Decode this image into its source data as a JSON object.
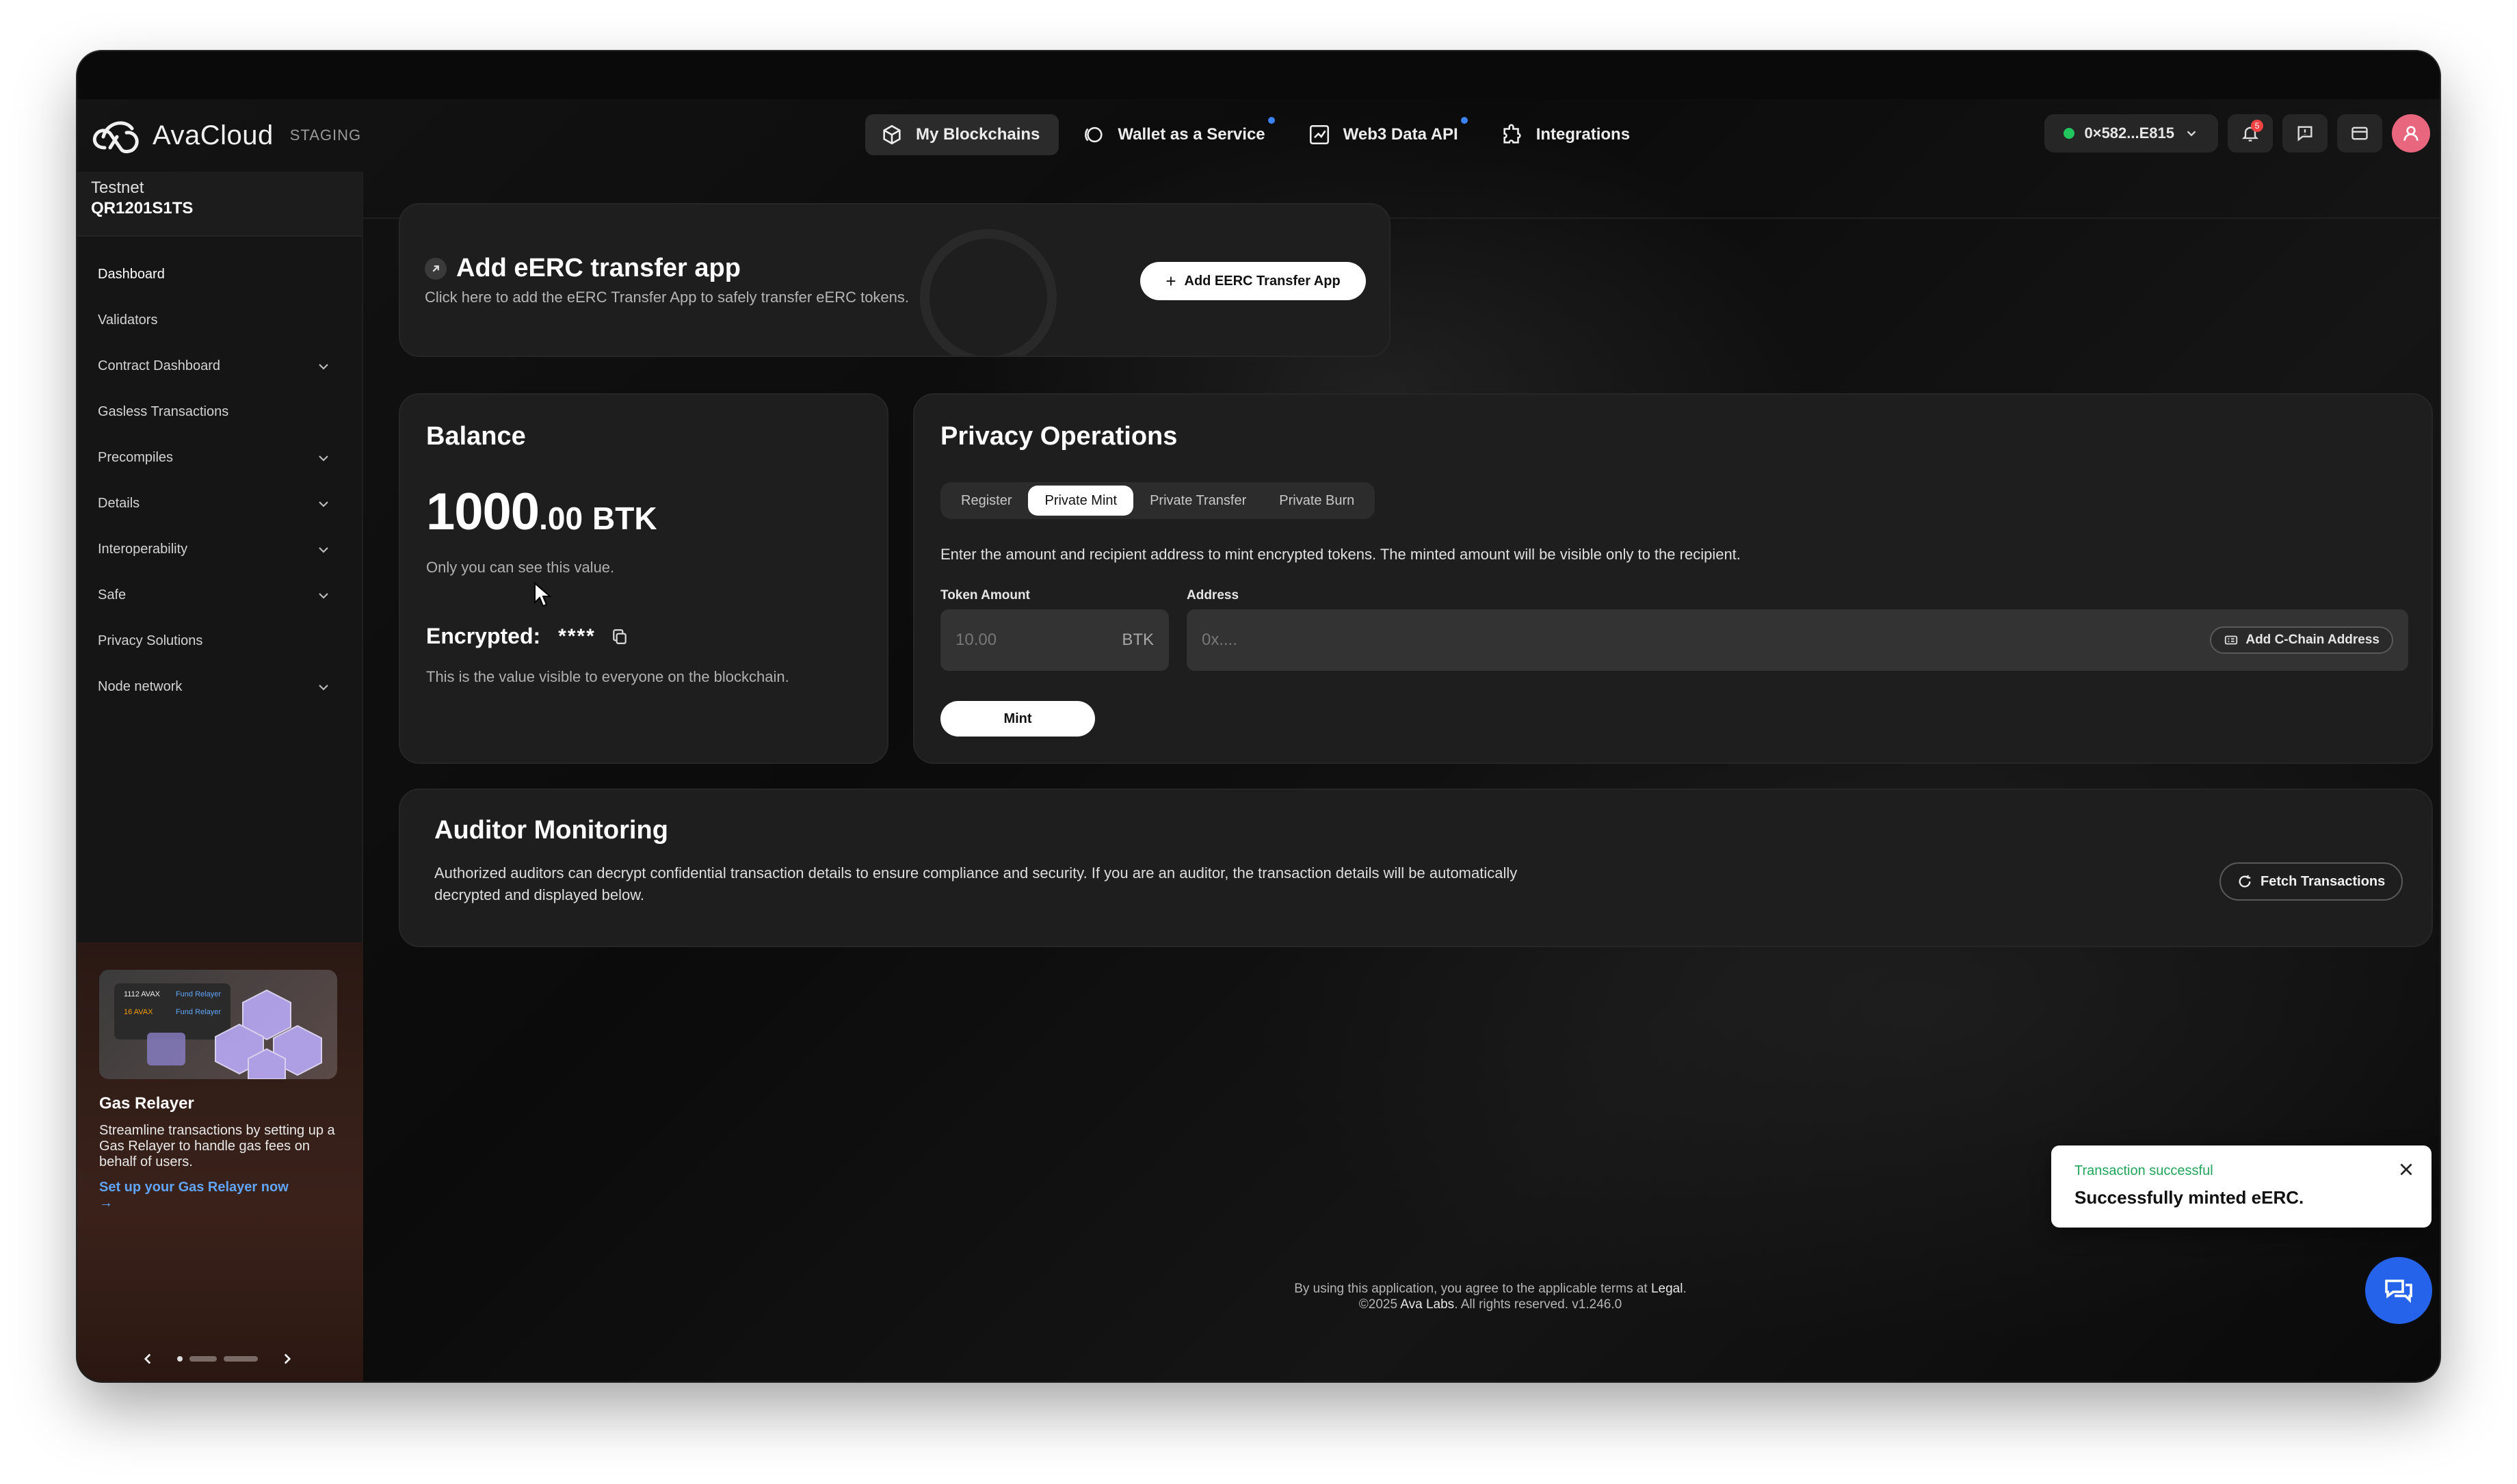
{
  "brand": {
    "name": "AvaCloud",
    "env": "STAGING"
  },
  "nav": {
    "items": [
      {
        "label": "My Blockchains",
        "icon": "blockchain-icon",
        "active": true,
        "dot": false
      },
      {
        "label": "Wallet as a Service",
        "icon": "wallet-icon",
        "active": false,
        "dot": true
      },
      {
        "label": "Web3 Data API",
        "icon": "chart-icon",
        "active": false,
        "dot": true
      },
      {
        "label": "Integrations",
        "icon": "puzzle-icon",
        "active": false,
        "dot": false
      }
    ],
    "wallet_address": "0×582...E815",
    "notification_count": "5"
  },
  "sidebar": {
    "network": "Testnet",
    "chain_id": "QR1201S1TS",
    "items": [
      {
        "label": "Dashboard",
        "expandable": false
      },
      {
        "label": "Validators",
        "expandable": false
      },
      {
        "label": "Contract Dashboard",
        "expandable": true
      },
      {
        "label": "Gasless Transactions",
        "expandable": false
      },
      {
        "label": "Precompiles",
        "expandable": true
      },
      {
        "label": "Details",
        "expandable": true
      },
      {
        "label": "Interoperability",
        "expandable": true
      },
      {
        "label": "Safe",
        "expandable": true
      },
      {
        "label": "Privacy Solutions",
        "expandable": false
      },
      {
        "label": "Node network",
        "expandable": true
      }
    ],
    "promo": {
      "art_line1": "1112 AVAX",
      "art_line2": "16 AVAX",
      "art_tag1": "Fund Relayer",
      "art_tag2": "Fund Relayer",
      "title": "Gas Relayer",
      "body": "Streamline transactions by setting up a Gas Relayer to handle gas fees on behalf of users.",
      "link": "Set up your Gas Relayer now",
      "link_arrow": "→"
    }
  },
  "add_app": {
    "title": "Add eERC transfer app",
    "subtitle": "Click here to add the eERC Transfer App to safely transfer eERC tokens.",
    "button": "Add EERC Transfer App"
  },
  "balance": {
    "title": "Balance",
    "integer": "1000",
    "decimal": ".00",
    "unit": "BTK",
    "note": "Only you can see this value.",
    "encrypted_label": "Encrypted:",
    "encrypted_value": "****",
    "encrypted_note": "This is the value visible to everyone on the blockchain."
  },
  "privacy": {
    "title": "Privacy Operations",
    "tabs": [
      {
        "label": "Register",
        "active": false
      },
      {
        "label": "Private Mint",
        "active": true
      },
      {
        "label": "Private Transfer",
        "active": false
      },
      {
        "label": "Private Burn",
        "active": false
      }
    ],
    "description": "Enter the amount and recipient address to mint encrypted tokens. The minted amount will be visible only to the recipient.",
    "amount_label": "Token Amount",
    "amount_placeholder": "10.00",
    "amount_unit": "BTK",
    "address_label": "Address",
    "address_placeholder": "0x....",
    "add_address_button": "Add C-Chain Address",
    "mint_button": "Mint"
  },
  "auditor": {
    "title": "Auditor Monitoring",
    "description": "Authorized auditors can decrypt confidential transaction details to ensure compliance and security. If you are an auditor, the transaction details will be automatically decrypted and displayed below.",
    "button": "Fetch Transactions"
  },
  "footer": {
    "line1_prefix": "By using this application, you agree to the applicable terms at",
    "line1_link": "Legal",
    "line1_suffix": ".",
    "line2_prefix": "©2025",
    "line2_company": "Ava Labs",
    "line2_suffix": ". All rights reserved.  v1.246.0"
  },
  "toast": {
    "status": "Transaction successful",
    "message": "Successfully minted eERC."
  },
  "colors": {
    "accent_blue": "#3b82f6",
    "success_green": "#22c55e",
    "fab_blue": "#2563eb",
    "avatar_pink": "#e8677f"
  }
}
